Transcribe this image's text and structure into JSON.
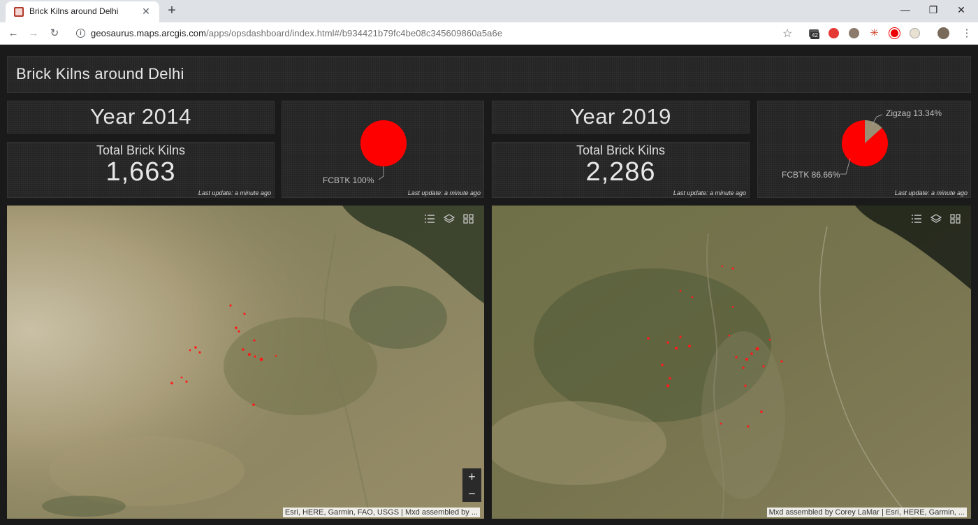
{
  "browser": {
    "tab_title": "Brick Kilns around Delhi",
    "tab_close": "✕",
    "new_tab": "+",
    "url_host": "geosaurus.maps.arcgis.com",
    "url_path": "/apps/opsdashboard/index.html#/b934421b79fc4be08c345609860a5a6e",
    "extension_badge": "42",
    "controls": {
      "back": "←",
      "forward": "→",
      "reload": "↻",
      "star": "☆",
      "minimize": "—",
      "maximize": "❐",
      "close": "✕"
    }
  },
  "dashboard": {
    "title": "Brick Kilns around Delhi",
    "left": {
      "year": "Year 2014",
      "kpi_label": "Total Brick Kilns",
      "kpi_value": "1,663",
      "kpi_updated": "Last update: a minute ago",
      "pie_updated": "Last update: a minute ago",
      "pie_label_fcbtk": "FCBTK 100%",
      "pie_slices": [
        {
          "name": "FCBTK",
          "percent": 100,
          "color": "#ff0000"
        }
      ],
      "map_attribution": "Esri, HERE, Garmin, FAO, USGS | Mxd assembled by ...",
      "zoom_in": "+",
      "zoom_out": "−"
    },
    "right": {
      "year": "Year 2019",
      "kpi_label": "Total Brick Kilns",
      "kpi_value": "2,286",
      "kpi_updated": "Last update: a minute ago",
      "pie_updated": "Last update: a minute ago",
      "pie_label_zigzag": "Zigzag 13.34%",
      "pie_label_fcbtk": "FCBTK 86.66%",
      "pie_slices": [
        {
          "name": "FCBTK",
          "percent": 86.66,
          "color": "#ff0000"
        },
        {
          "name": "Zigzag",
          "percent": 13.34,
          "color": "#9a8f74"
        }
      ],
      "map_attribution": "Mxd assembled by Corey LaMar | Esri, HERE, Garmin, ..."
    }
  },
  "colors": {
    "panel_bg": "#242424",
    "kiln_marker": "#ff1a1a",
    "fcbtk": "#ff0000",
    "zigzag": "#9a8f74"
  }
}
